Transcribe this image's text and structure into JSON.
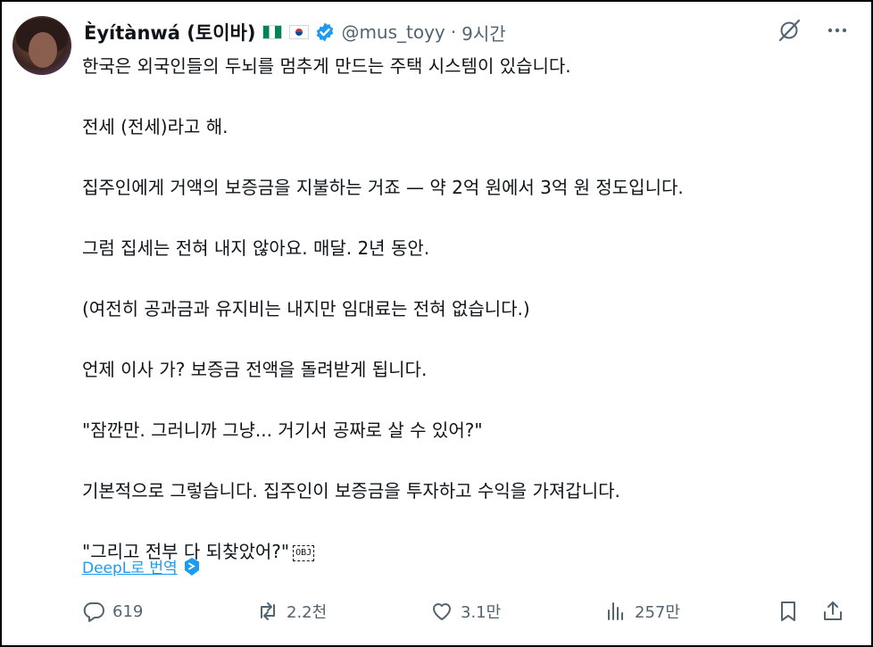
{
  "author": {
    "name": "Èyítànwá (토이바)",
    "handle": "@mus_toyy",
    "separator": "·",
    "time": "9시간"
  },
  "icons": {
    "grok": "grok-icon",
    "more": "more-icon",
    "verified": "verified-badge-icon",
    "deepl": "deepl-icon",
    "reply": "reply-icon",
    "retweet": "retweet-icon",
    "like": "like-icon",
    "views": "views-icon",
    "bookmark": "bookmark-icon",
    "share": "share-icon"
  },
  "colors": {
    "accent": "#1d9bf0",
    "muted": "#536471",
    "text": "#0f1419"
  },
  "post": {
    "paragraphs": [
      "한국은 외국인들의 두뇌를 멈추게 만드는 주택 시스템이 있습니다.",
      "전세 (전세)라고 해.",
      "집주인에게 거액의 보증금을 지불하는 거죠 — 약 2억 원에서 3억 원 정도입니다.",
      "그럼 집세는 전혀 내지 않아요. 매달. 2년 동안.",
      "(여전히 공과금과 유지비는 내지만 임대료는 전혀 없습니다.)",
      "언제 이사 가? 보증금 전액을 돌려받게 됩니다.",
      "\"잠깐만. 그러니까 그냥... 거기서 공짜로 살 수 있어?\"",
      "기본적으로 그렇습니다. 집주인이 보증금을 투자하고 수익을 가져갑니다.",
      "\"그리고 전부 다 되찾았어?\""
    ],
    "object_marker": "OBJ",
    "translate_label": "DeepL로 번역"
  },
  "actions": {
    "replies": "619",
    "reposts": "2.2천",
    "likes": "3.1만",
    "views": "257만"
  }
}
